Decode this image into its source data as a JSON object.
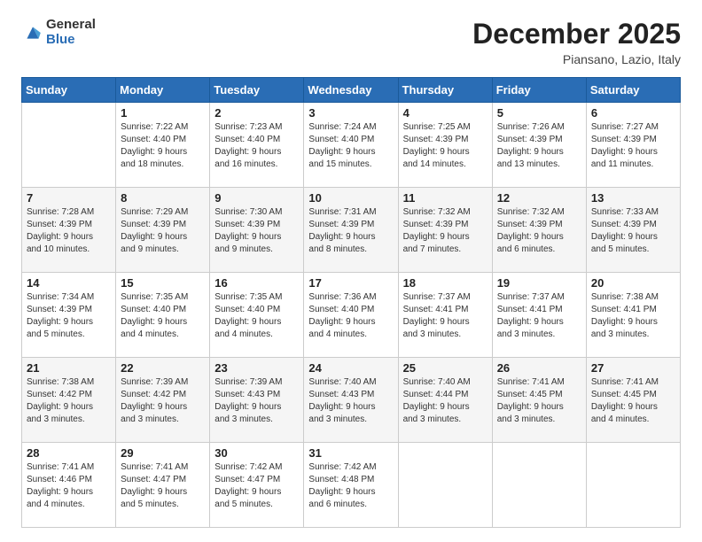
{
  "logo": {
    "general": "General",
    "blue": "Blue"
  },
  "header": {
    "month": "December 2025",
    "location": "Piansano, Lazio, Italy"
  },
  "days": [
    "Sunday",
    "Monday",
    "Tuesday",
    "Wednesday",
    "Thursday",
    "Friday",
    "Saturday"
  ],
  "weeks": [
    [
      {
        "day": "",
        "info": ""
      },
      {
        "day": "1",
        "info": "Sunrise: 7:22 AM\nSunset: 4:40 PM\nDaylight: 9 hours\nand 18 minutes."
      },
      {
        "day": "2",
        "info": "Sunrise: 7:23 AM\nSunset: 4:40 PM\nDaylight: 9 hours\nand 16 minutes."
      },
      {
        "day": "3",
        "info": "Sunrise: 7:24 AM\nSunset: 4:40 PM\nDaylight: 9 hours\nand 15 minutes."
      },
      {
        "day": "4",
        "info": "Sunrise: 7:25 AM\nSunset: 4:39 PM\nDaylight: 9 hours\nand 14 minutes."
      },
      {
        "day": "5",
        "info": "Sunrise: 7:26 AM\nSunset: 4:39 PM\nDaylight: 9 hours\nand 13 minutes."
      },
      {
        "day": "6",
        "info": "Sunrise: 7:27 AM\nSunset: 4:39 PM\nDaylight: 9 hours\nand 11 minutes."
      }
    ],
    [
      {
        "day": "7",
        "info": "Sunrise: 7:28 AM\nSunset: 4:39 PM\nDaylight: 9 hours\nand 10 minutes."
      },
      {
        "day": "8",
        "info": "Sunrise: 7:29 AM\nSunset: 4:39 PM\nDaylight: 9 hours\nand 9 minutes."
      },
      {
        "day": "9",
        "info": "Sunrise: 7:30 AM\nSunset: 4:39 PM\nDaylight: 9 hours\nand 9 minutes."
      },
      {
        "day": "10",
        "info": "Sunrise: 7:31 AM\nSunset: 4:39 PM\nDaylight: 9 hours\nand 8 minutes."
      },
      {
        "day": "11",
        "info": "Sunrise: 7:32 AM\nSunset: 4:39 PM\nDaylight: 9 hours\nand 7 minutes."
      },
      {
        "day": "12",
        "info": "Sunrise: 7:32 AM\nSunset: 4:39 PM\nDaylight: 9 hours\nand 6 minutes."
      },
      {
        "day": "13",
        "info": "Sunrise: 7:33 AM\nSunset: 4:39 PM\nDaylight: 9 hours\nand 5 minutes."
      }
    ],
    [
      {
        "day": "14",
        "info": "Sunrise: 7:34 AM\nSunset: 4:39 PM\nDaylight: 9 hours\nand 5 minutes."
      },
      {
        "day": "15",
        "info": "Sunrise: 7:35 AM\nSunset: 4:40 PM\nDaylight: 9 hours\nand 4 minutes."
      },
      {
        "day": "16",
        "info": "Sunrise: 7:35 AM\nSunset: 4:40 PM\nDaylight: 9 hours\nand 4 minutes."
      },
      {
        "day": "17",
        "info": "Sunrise: 7:36 AM\nSunset: 4:40 PM\nDaylight: 9 hours\nand 4 minutes."
      },
      {
        "day": "18",
        "info": "Sunrise: 7:37 AM\nSunset: 4:41 PM\nDaylight: 9 hours\nand 3 minutes."
      },
      {
        "day": "19",
        "info": "Sunrise: 7:37 AM\nSunset: 4:41 PM\nDaylight: 9 hours\nand 3 minutes."
      },
      {
        "day": "20",
        "info": "Sunrise: 7:38 AM\nSunset: 4:41 PM\nDaylight: 9 hours\nand 3 minutes."
      }
    ],
    [
      {
        "day": "21",
        "info": "Sunrise: 7:38 AM\nSunset: 4:42 PM\nDaylight: 9 hours\nand 3 minutes."
      },
      {
        "day": "22",
        "info": "Sunrise: 7:39 AM\nSunset: 4:42 PM\nDaylight: 9 hours\nand 3 minutes."
      },
      {
        "day": "23",
        "info": "Sunrise: 7:39 AM\nSunset: 4:43 PM\nDaylight: 9 hours\nand 3 minutes."
      },
      {
        "day": "24",
        "info": "Sunrise: 7:40 AM\nSunset: 4:43 PM\nDaylight: 9 hours\nand 3 minutes."
      },
      {
        "day": "25",
        "info": "Sunrise: 7:40 AM\nSunset: 4:44 PM\nDaylight: 9 hours\nand 3 minutes."
      },
      {
        "day": "26",
        "info": "Sunrise: 7:41 AM\nSunset: 4:45 PM\nDaylight: 9 hours\nand 3 minutes."
      },
      {
        "day": "27",
        "info": "Sunrise: 7:41 AM\nSunset: 4:45 PM\nDaylight: 9 hours\nand 4 minutes."
      }
    ],
    [
      {
        "day": "28",
        "info": "Sunrise: 7:41 AM\nSunset: 4:46 PM\nDaylight: 9 hours\nand 4 minutes."
      },
      {
        "day": "29",
        "info": "Sunrise: 7:41 AM\nSunset: 4:47 PM\nDaylight: 9 hours\nand 5 minutes."
      },
      {
        "day": "30",
        "info": "Sunrise: 7:42 AM\nSunset: 4:47 PM\nDaylight: 9 hours\nand 5 minutes."
      },
      {
        "day": "31",
        "info": "Sunrise: 7:42 AM\nSunset: 4:48 PM\nDaylight: 9 hours\nand 6 minutes."
      },
      {
        "day": "",
        "info": ""
      },
      {
        "day": "",
        "info": ""
      },
      {
        "day": "",
        "info": ""
      }
    ]
  ]
}
